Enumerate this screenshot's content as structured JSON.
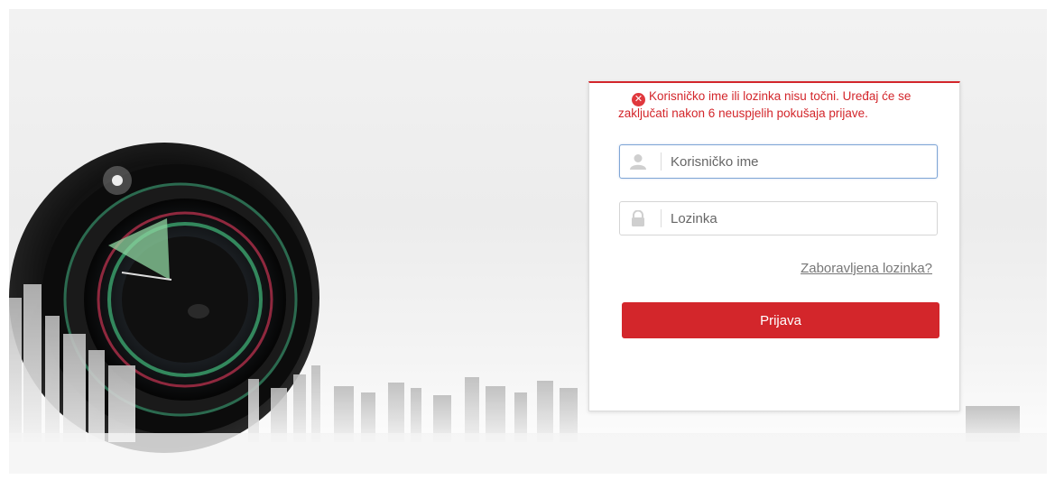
{
  "login": {
    "error_message": "Korisničko ime ili lozinka nisu točni. Uređaj će se zaključati nakon 6 neuspjelih pokušaja prijave.",
    "username_placeholder": "Korisničko ime",
    "password_placeholder": "Lozinka",
    "forgot_password_label": "Zaboravljena lozinka?",
    "login_button_label": "Prijava"
  },
  "icons": {
    "error": "error-x-circle-icon",
    "user": "user-icon",
    "lock": "lock-icon"
  },
  "colors": {
    "accent": "#d3262b",
    "error": "#e0383d",
    "link": "#777777"
  }
}
